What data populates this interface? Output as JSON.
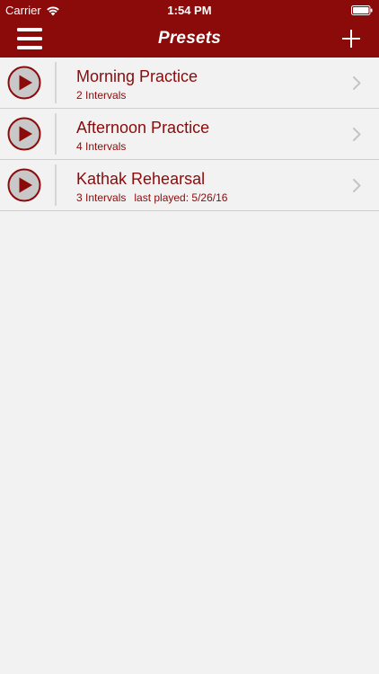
{
  "status_bar": {
    "carrier": "Carrier",
    "time": "1:54 PM",
    "icons": [
      "wifi-icon",
      "battery-icon"
    ]
  },
  "nav": {
    "title": "Presets",
    "left_icon": "menu-icon",
    "right_icon": "plus-icon"
  },
  "colors": {
    "brand": "#8b0a0a",
    "background": "#f2f2f2",
    "separator": "#cfcfcf",
    "play_fill": "#c8c8c8",
    "chevron": "#c4c4c4"
  },
  "presets": [
    {
      "title": "Morning Practice",
      "intervals": "2 Intervals",
      "last_played": ""
    },
    {
      "title": "Afternoon Practice",
      "intervals": "4 Intervals",
      "last_played": ""
    },
    {
      "title": "Kathak Rehearsal",
      "intervals": "3 Intervals",
      "last_played": "last played: 5/26/16"
    }
  ]
}
